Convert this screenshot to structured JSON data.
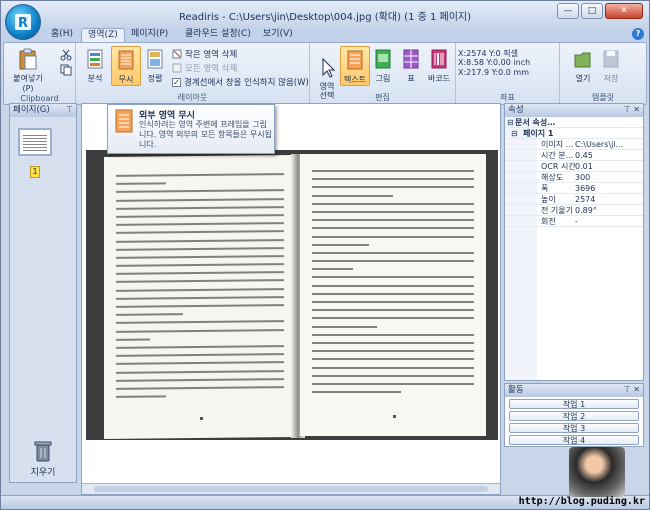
{
  "window": {
    "title": "Readiris - C:\\Users\\jin\\Desktop\\004.jpg (확대) (1 중 1 페이지)",
    "buttons": {
      "minimize": "—",
      "maximize": "□",
      "close": "✕"
    }
  },
  "tabs": [
    {
      "label": "홈(H)"
    },
    {
      "label": "영역(Z)"
    },
    {
      "label": "페이지(P)"
    },
    {
      "label": "클라우드 설정(C)"
    },
    {
      "label": "보기(V)"
    }
  ],
  "ribbon": {
    "clipboard": {
      "paste": "붙여넣기(P)",
      "label": "Clipboard"
    },
    "layout": {
      "analyze": "분석",
      "ignore": "무시",
      "arrange": "정렬",
      "delete_small": "작은 영역 삭제",
      "delete_all": "모든 영역 삭제",
      "border_check": "경계선에서 창을 인식하지 않음(W)",
      "border_checked": "✓",
      "label": "레이아웃"
    },
    "edit": {
      "select": "영역\n선택",
      "text": "텍스트",
      "image": "그림",
      "table": "표",
      "barcode": "바코드",
      "label": "편집"
    },
    "coords": {
      "line1": "X:2574 Y:0 픽셀",
      "line2": "X:8.58 Y:0.00 inch",
      "line3": "X:217.9 Y:0.0 mm",
      "label": "좌표"
    },
    "template": {
      "open": "열기",
      "save": "저장",
      "label": "템플릿"
    }
  },
  "pages_panel": {
    "title": "페이지(G)",
    "thumb_number": "1",
    "delete_label": "지우기"
  },
  "tooltip": {
    "title": "외부 영역 무시",
    "body": "인식하려는 영역 주변에 프레임을 그립니다. 영역 외부의 모든 항목들은 무시됩니다."
  },
  "properties": {
    "title": "속성",
    "header": "문서 속성…",
    "page_header": "페이지 1",
    "rows": [
      {
        "key": "이미지 ...",
        "value": "C:\\Users\\ji..."
      },
      {
        "key": "시간 분...",
        "value": "0.45"
      },
      {
        "key": "OCR 시간",
        "value": "0.01"
      },
      {
        "key": "해상도",
        "value": "300"
      },
      {
        "key": "폭",
        "value": "3696"
      },
      {
        "key": "높이",
        "value": "2574"
      },
      {
        "key": "전 기울기",
        "value": "0.89°"
      },
      {
        "key": "회전",
        "value": "-"
      }
    ]
  },
  "activity": {
    "title": "활동",
    "tasks": [
      "작업 1",
      "작업 2",
      "작업 3",
      "작업 4"
    ]
  },
  "watermark": "http://blog.puding.kr"
}
